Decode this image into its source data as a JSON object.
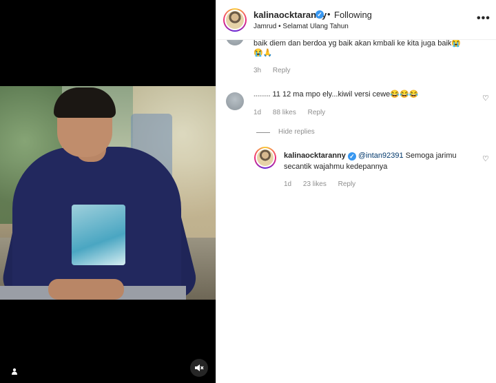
{
  "post": {
    "username": "kalinaocktaranny",
    "follow_status": "Following",
    "separator": "•",
    "subtitle": "Jamrud • Selamat Ulang Tahun",
    "more_icon": "ellipsis-icon",
    "verified_glyph": "✓"
  },
  "media": {
    "user_tag_icon": "person-icon",
    "mute_icon": "speaker-muted-icon"
  },
  "comments": [
    {
      "text": "baik diem dan berdoa yg baik akan kmbali ke kita juga baik😭",
      "text2": "😭🙏",
      "time": "3h",
      "reply_label": "Reply"
    },
    {
      "username": "........",
      "text": "11 12 ma mpo ely...kiwil versi cewe😂😂😂",
      "time": "1d",
      "likes": "88 likes",
      "reply_label": "Reply"
    }
  ],
  "hide_replies_label": "Hide replies",
  "reply": {
    "username": "kalinaocktaranny",
    "mention": "@intan92391",
    "text_line1": "Semoga jarimu",
    "text_line2": "secantik wajahmu kedepannya",
    "time": "1d",
    "likes": "23 likes",
    "reply_label": "Reply"
  }
}
